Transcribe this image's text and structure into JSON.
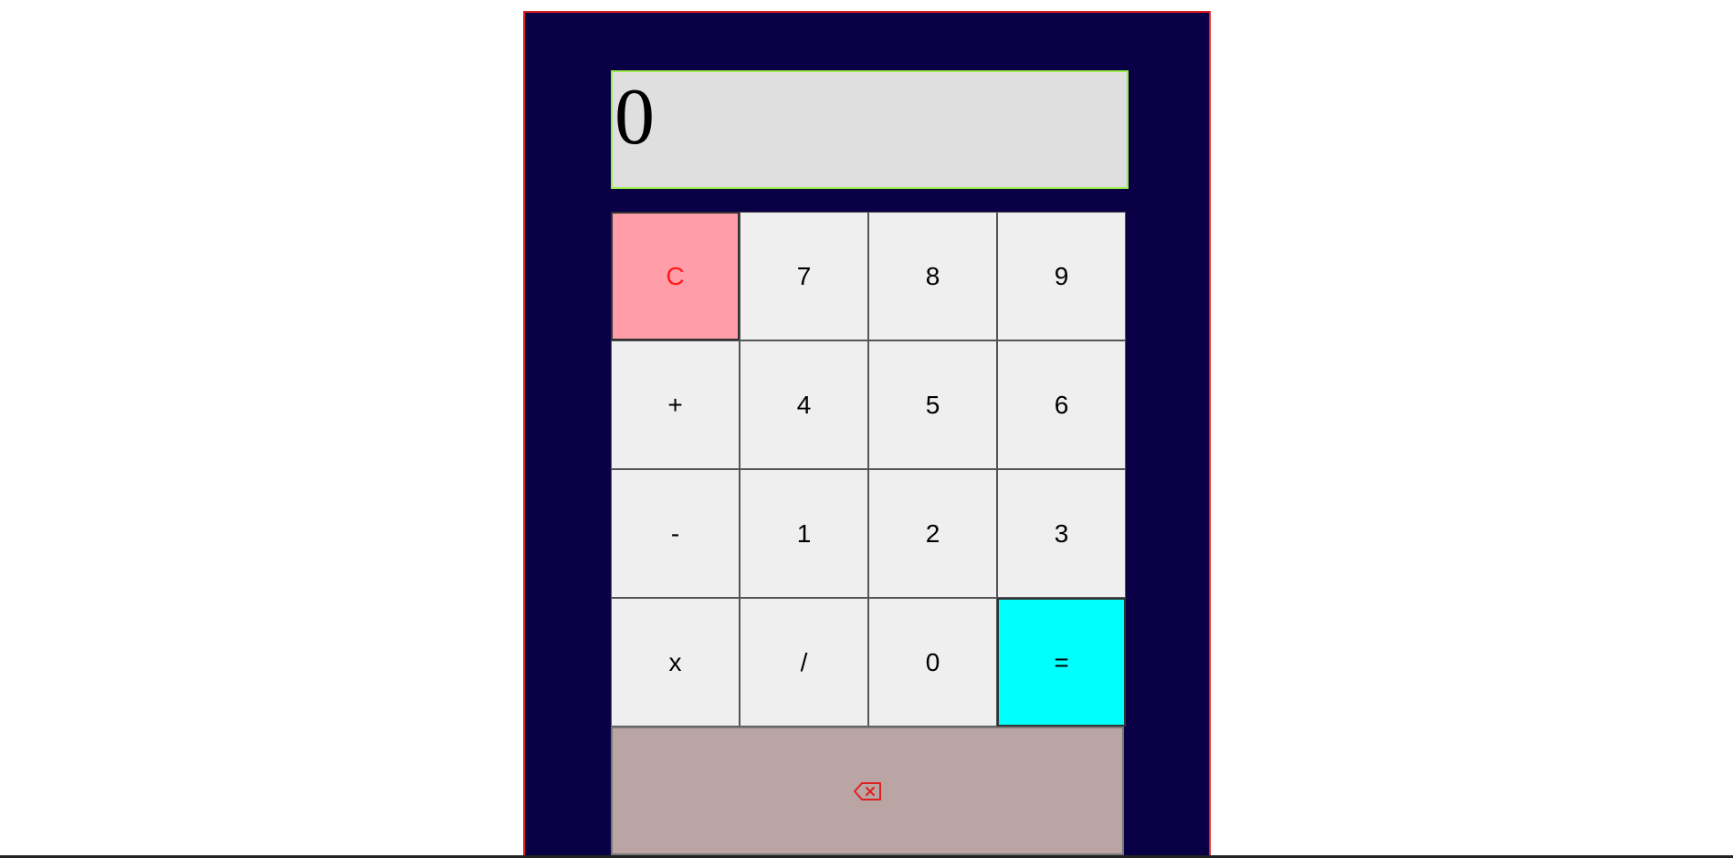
{
  "display": {
    "value": "0"
  },
  "keys": {
    "clear": "C",
    "seven": "7",
    "eight": "8",
    "nine": "9",
    "plus": "+",
    "four": "4",
    "five": "5",
    "six": "6",
    "minus": "-",
    "one": "1",
    "two": "2",
    "three": "3",
    "multiply": "x",
    "divide": "/",
    "zero": "0",
    "equals": "="
  },
  "backspace": {
    "icon": "backspace-icon"
  },
  "colors": {
    "frame": "#0a0045",
    "frame_border": "#e02020",
    "display_bg": "#dfdfdf",
    "display_border": "#9aeb4a",
    "key_bg": "#efefef",
    "clear_bg": "#ff9ea8",
    "clear_text": "#ff1a1a",
    "equals_bg": "#00ffff",
    "backspace_bg": "#baa5a4",
    "backspace_icon": "#e02020"
  }
}
